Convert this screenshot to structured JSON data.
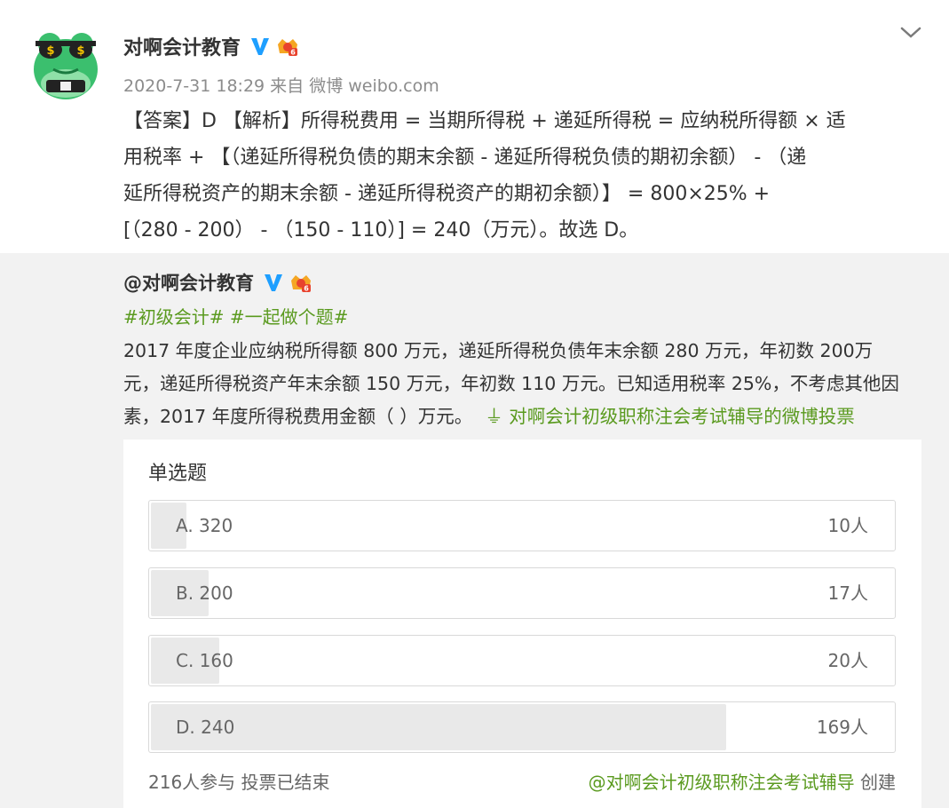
{
  "post": {
    "author": "对啊会计教育",
    "meta": "2020-7-31 18:29 来自 微博 weibo.com",
    "answer_lines": [
      "【答案】D 【解析】所得税费用 = 当期所得税 + 递延所得税 = 应纳税所得额 × 适",
      "用税率 + 【（递延所得税负债的期末余额 - 递延所得税负债的期初余额） - （递",
      "延所得税资产的期末余额 - 递延所得税资产的期初余额）】 = 800×25% +",
      "[（280 - 200） - （150 - 110）] = 240（万元）。故选 D。"
    ]
  },
  "repost": {
    "author": "@对啊会计教育",
    "tags": "#初级会计# #一起做个题#",
    "text_lines": [
      "2017 年度企业应纳税所得额 800 万元，递延所得税负债年末余额 280 万元，年初数 200万",
      "元，递延所得税资产年末余额 150 万元，年初数 110 万元。已知适用税率 25%，不考虑其他因",
      "素，2017 年度所得税费用金额（ ）万元。"
    ],
    "vote_link": "⏚ 对啊会计初级职称注会考试辅导的微博投票"
  },
  "poll": {
    "title": "单选题",
    "total": 216,
    "options": [
      {
        "label": "A. 320",
        "count": "10人",
        "votes": 10
      },
      {
        "label": "B. 200",
        "count": "17人",
        "votes": 17
      },
      {
        "label": "C. 160",
        "count": "20人",
        "votes": 20
      },
      {
        "label": "D. 240",
        "count": "169人",
        "votes": 169
      }
    ],
    "footer_left": "216人参与 投票已结束",
    "footer_creator": "@对啊会计初级职称注会考试辅导",
    "footer_created": " 创建"
  },
  "colors": {
    "link_green": "#5a9a1f",
    "verified_blue": "#1e9fff",
    "bar_fill": "#e9e9e9"
  },
  "icons": {
    "avatar": "frog-sunglasses-avatar",
    "verified": "verified-v-icon",
    "member": "member-crown-icon",
    "menu": "chevron-down-icon"
  }
}
